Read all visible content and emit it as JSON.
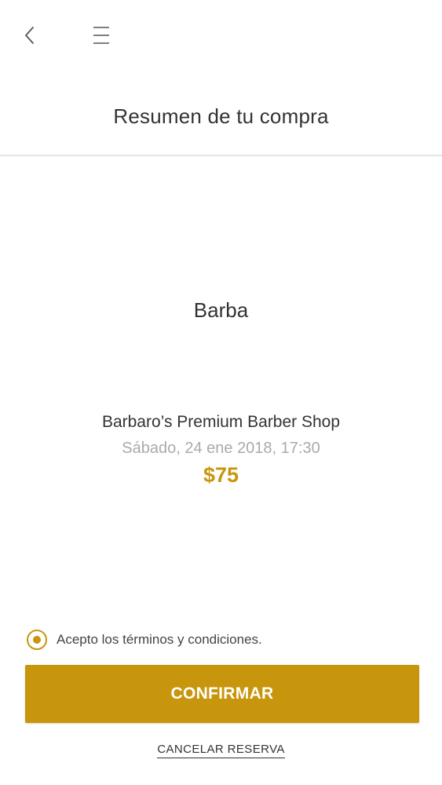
{
  "header": {
    "back_icon": "chevron-left-icon",
    "menu_icon": "hamburger-menu-icon",
    "title": "Resumen de tu compra"
  },
  "summary": {
    "service": "Barba",
    "shop": "Barbaro’s Premium Barber Shop",
    "datetime": "Sábado, 24 ene 2018, 17:30",
    "price": "$75"
  },
  "terms": {
    "checked": true,
    "label": "Acepto los términos y condiciones."
  },
  "actions": {
    "confirm_label": "CONFIRMAR",
    "cancel_label": "CANCELAR RESERVA"
  },
  "colors": {
    "accent": "#c8960c",
    "text": "#333333",
    "muted": "#aaaaaa",
    "divider": "#e4e4e4"
  }
}
